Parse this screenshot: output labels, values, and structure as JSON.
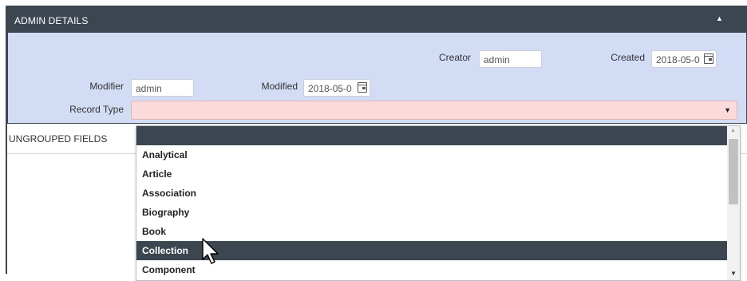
{
  "admin_details": {
    "title": "ADMIN DETAILS",
    "collapse_glyph": "▲",
    "creator": {
      "label": "Creator",
      "value": "admin"
    },
    "created": {
      "label": "Created",
      "value": "2018-05-0"
    },
    "modifier": {
      "label": "Modifier",
      "value": "admin"
    },
    "modified": {
      "label": "Modified",
      "value": "2018-05-0"
    },
    "record_type": {
      "label": "Record Type",
      "value": "",
      "caret": "▼"
    }
  },
  "ungrouped": {
    "title": "UNGROUPED FIELDS"
  },
  "dropdown": {
    "options": [
      "",
      "Analytical",
      "Article",
      "Association",
      "Biography",
      "Book",
      "Collection",
      "Component"
    ],
    "highlighted": "Collection",
    "scroll_up": "▲",
    "scroll_down": "▼"
  },
  "colors": {
    "header_bg": "#3b4650",
    "panel_bg": "#d2dcf4",
    "invalid_select_bg": "#fadada",
    "highlight_bg": "#3b4650"
  }
}
